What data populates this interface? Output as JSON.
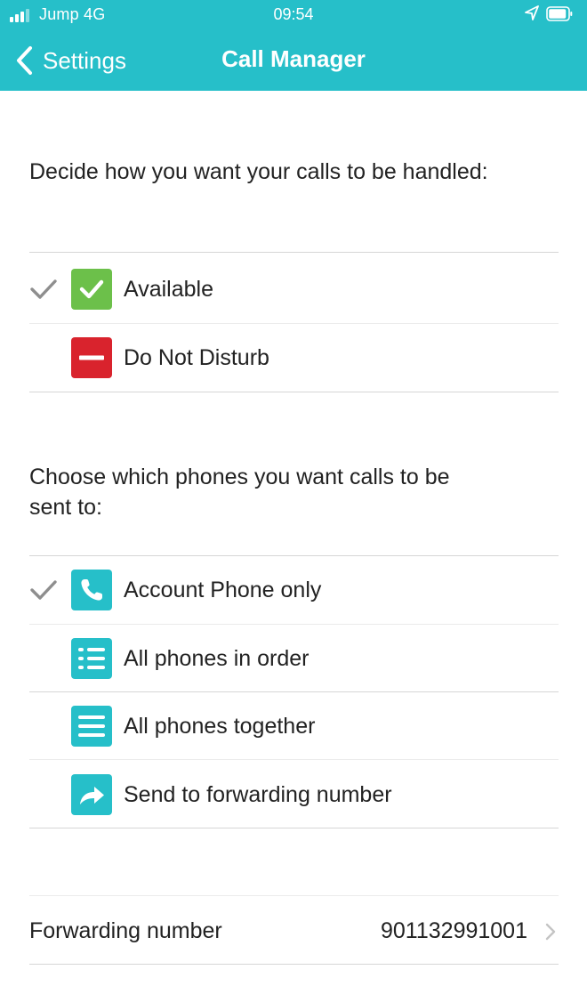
{
  "status_bar": {
    "carrier": "Jump",
    "network": "4G",
    "time": "09:54"
  },
  "nav": {
    "back_label": "Settings",
    "title": "Call Manager"
  },
  "availability": {
    "prompt": "Decide how you want your calls to be handled:",
    "options": [
      {
        "label": "Available",
        "icon": "check-icon",
        "color": "#6cc04a",
        "selected": true
      },
      {
        "label": "Do Not Disturb",
        "icon": "minus-icon",
        "color": "#d9232d",
        "selected": false
      }
    ]
  },
  "routing": {
    "prompt_line1": "Choose which phones you want calls to be",
    "prompt_line2": "sent to:",
    "options": [
      {
        "label": "Account Phone only",
        "icon": "phone-icon",
        "selected": true
      },
      {
        "label": "All phones in order",
        "icon": "ordered-list-icon",
        "selected": false
      },
      {
        "label": "All phones together",
        "icon": "list-icon",
        "selected": false
      },
      {
        "label": "Send to forwarding number",
        "icon": "forward-arrow-icon",
        "selected": false
      }
    ],
    "icon_color": "#26bfc9"
  },
  "forwarding": {
    "label": "Forwarding number",
    "value": "901132991001"
  },
  "colors": {
    "accent": "#26bfc9",
    "checkmark": "#8e8e8e"
  }
}
